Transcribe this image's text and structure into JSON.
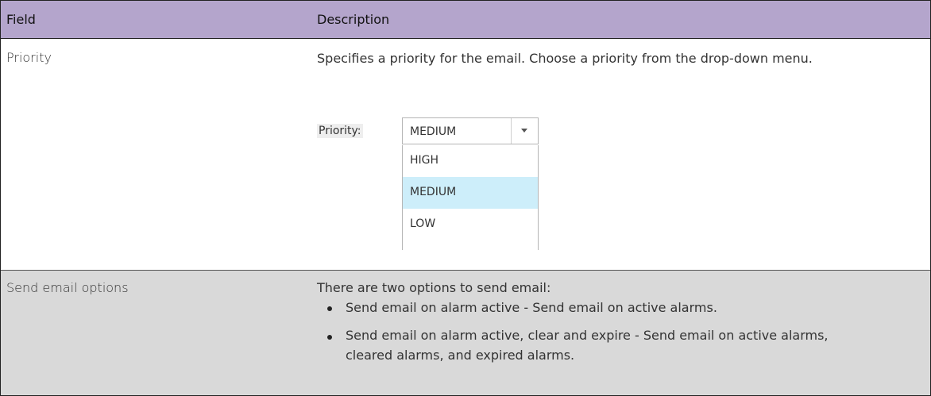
{
  "header": {
    "field": "Field",
    "description": "Description"
  },
  "rows": [
    {
      "field": "Priority",
      "description": "Specifies a priority for the email. Choose a priority from the drop-down menu.",
      "widget": {
        "label": "Priority:",
        "selected": "MEDIUM",
        "options": [
          "HIGH",
          "MEDIUM",
          "LOW"
        ],
        "highlighted_option": "MEDIUM"
      }
    },
    {
      "field": "Send email options",
      "intro": "There are two options to send email:",
      "bullets": [
        "Send email on alarm active - Send email on active alarms.",
        "Send email on alarm active, clear and expire - Send email on active alarms, cleared alarms, and expired alarms."
      ]
    }
  ],
  "colors": {
    "header_bg": "#b4a5cc",
    "row2_bg": "#d9d9d9",
    "highlight": "#cdeefa"
  }
}
